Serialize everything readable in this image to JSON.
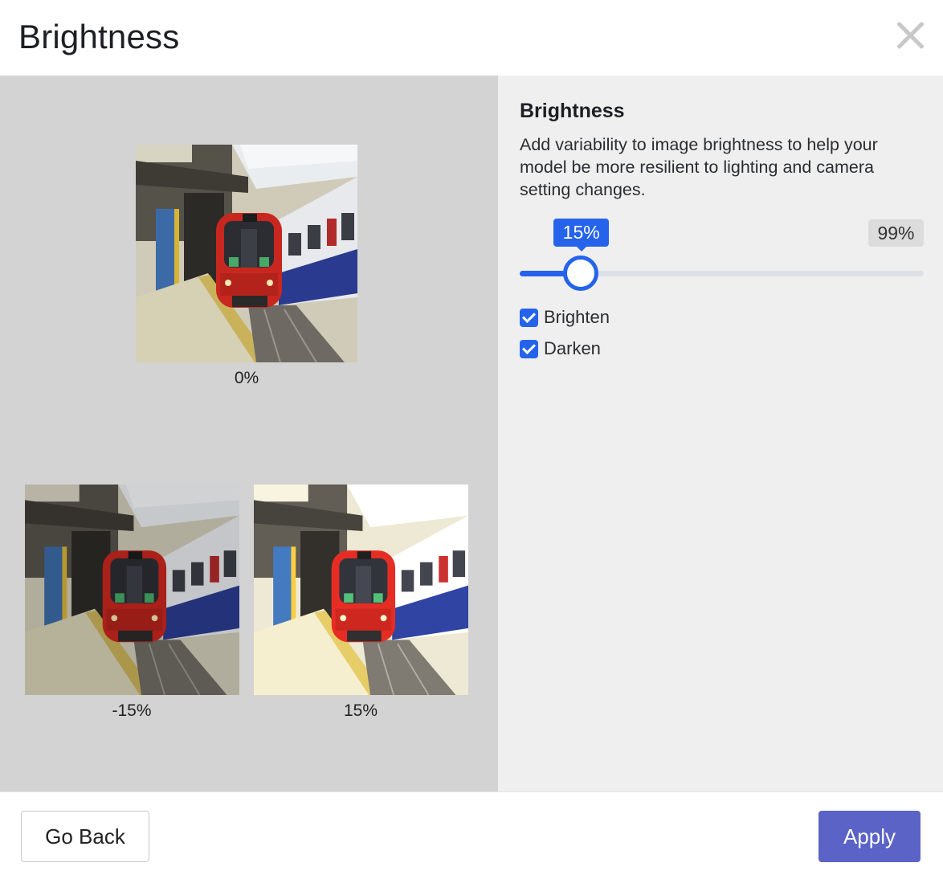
{
  "header": {
    "title": "Brightness",
    "close_icon": "close-icon"
  },
  "preview": {
    "images": [
      {
        "label": "0%",
        "brightness": 0
      },
      {
        "label": "-15%",
        "brightness": -15
      },
      {
        "label": "15%",
        "brightness": 15
      }
    ]
  },
  "settings": {
    "title": "Brightness",
    "description": "Add variability to image brightness to help your model be more resilient to lighting and camera setting changes.",
    "slider": {
      "value_label": "15%",
      "max_label": "99%",
      "value": 15,
      "max": 99
    },
    "options": [
      {
        "label": "Brighten",
        "checked": true
      },
      {
        "label": "Darken",
        "checked": true
      }
    ]
  },
  "footer": {
    "back_label": "Go Back",
    "apply_label": "Apply"
  },
  "colors": {
    "accent": "#2563eb",
    "apply": "#5b63c7",
    "preview_bg": "#d3d3d3",
    "panel_bg": "#efefef"
  }
}
